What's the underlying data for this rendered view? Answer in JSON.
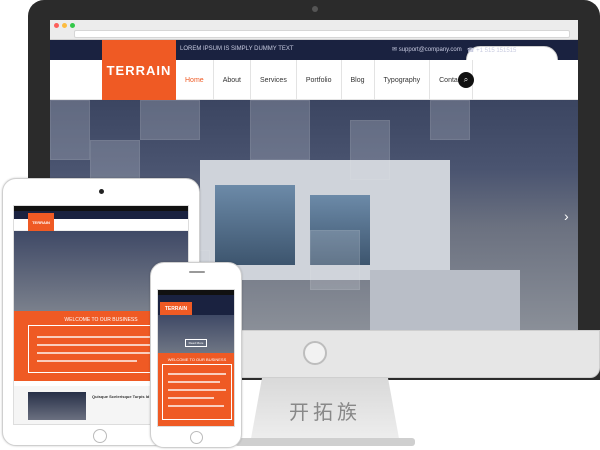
{
  "website": {
    "tagline": "LOREM IPSUM IS SIMPLY DUMMY TEXT",
    "email": "support@company.com",
    "phone": "+1 515 151515",
    "logo": "TERRAIN",
    "menu": [
      {
        "label": "Home",
        "active": true
      },
      {
        "label": "About"
      },
      {
        "label": "Services"
      },
      {
        "label": "Portfolio"
      },
      {
        "label": "Blog"
      },
      {
        "label": "Typography"
      },
      {
        "label": "Contact"
      }
    ],
    "welcome_heading": "WELCOME TO OUR BUSINESS",
    "post_title": "Quisque Scelerisque Turpis Id Nunc",
    "hero_button": "Read More"
  },
  "stand_text": "开拓族",
  "colors": {
    "accent": "#ef5a24",
    "topbar": "#1a2240",
    "bezel": "#2b2b2b"
  },
  "icons": [
    "search-icon",
    "mail-icon",
    "phone-icon",
    "chevron-right-icon"
  ]
}
